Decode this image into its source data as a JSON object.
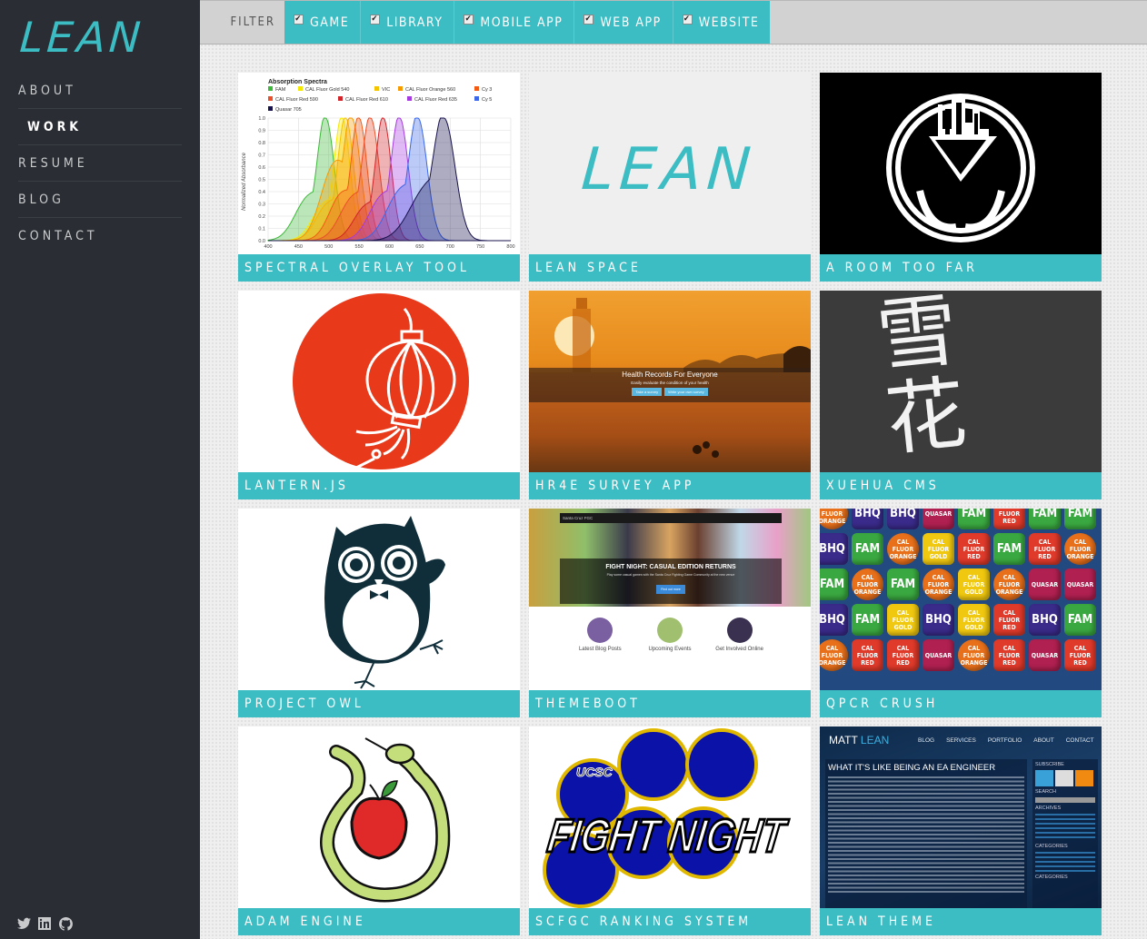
{
  "brand": {
    "logo": "LEAN",
    "accent": "#3cbcc3"
  },
  "nav": {
    "items": [
      {
        "label": "ABOUT",
        "active": false
      },
      {
        "label": "WORK",
        "active": true
      },
      {
        "label": "RESUME",
        "active": false
      },
      {
        "label": "BLOG",
        "active": false
      },
      {
        "label": "CONTACT",
        "active": false
      }
    ]
  },
  "social": [
    "twitter-icon",
    "linkedin-icon",
    "github-icon"
  ],
  "filter": {
    "label": "FILTER",
    "options": [
      {
        "label": "GAME",
        "checked": true
      },
      {
        "label": "LIBRARY",
        "checked": true
      },
      {
        "label": "MOBILE APP",
        "checked": true
      },
      {
        "label": "WEB APP",
        "checked": true
      },
      {
        "label": "WEBSITE",
        "checked": true
      }
    ]
  },
  "projects": [
    {
      "title": "SPECTRAL OVERLAY TOOL"
    },
    {
      "title": "LEAN SPACE",
      "thumb_text": "LEAN"
    },
    {
      "title": "A ROOM TOO FAR"
    },
    {
      "title": "LANTERN.JS"
    },
    {
      "title": "HR4E SURVEY APP",
      "thumb_heading": "Health Records For Everyone",
      "thumb_sub": "Easily evaluate the condition of your health",
      "thumb_btn1": "Take a survey",
      "thumb_btn2": "Write your own survey"
    },
    {
      "title": "XUEHUA CMS",
      "thumb_text": "雪花"
    },
    {
      "title": "PROJECT OWL"
    },
    {
      "title": "THEMEBOOT",
      "thumb_brand": "Santa Cruz FGC",
      "thumb_heading": "FIGHT NIGHT: CASUAL EDITION RETURNS",
      "thumb_sub": "Play some casual games with the Santa Cruz Fighting Game Community at the new venue",
      "thumb_btn": "Find out more",
      "cols": [
        "Latest Blog Posts",
        "Upcoming Events",
        "Get Involved Online"
      ]
    },
    {
      "title": "QPCR CRUSH",
      "gems": [
        "CAL FLUOR ORANGE",
        "BHQ",
        "BHQ",
        "QUASAR",
        "FAM",
        "CAL FLUOR RED",
        "FAM",
        "FAM",
        "BHQ",
        "FAM",
        "CAL FLUOR ORANGE",
        "CAL FLUOR GOLD",
        "CAL FLUOR RED",
        "FAM",
        "CAL FLUOR RED",
        "CAL FLUOR ORANGE",
        "FAM",
        "CAL FLUOR ORANGE",
        "FAM",
        "CAL FLUOR ORANGE",
        "CAL FLUOR GOLD",
        "CAL FLUOR ORANGE",
        "QUASAR",
        "QUASAR",
        "BHQ",
        "FAM",
        "CAL FLUOR GOLD",
        "BHQ",
        "CAL FLUOR GOLD",
        "CAL FLUOR RED",
        "BHQ",
        "FAM",
        "CAL FLUOR ORANGE",
        "CAL FLUOR RED",
        "CAL FLUOR RED",
        "QUASAR",
        "CAL FLUOR ORANGE",
        "CAL FLUOR RED",
        "QUASAR",
        "CAL FLUOR RED"
      ]
    },
    {
      "title": "ADAM ENGINE"
    },
    {
      "title": "SCFGC RANKING SYSTEM",
      "thumb_small": "UCSC",
      "thumb_text": "FIGHT NIGHT"
    },
    {
      "title": "LEAN THEME",
      "thumb_brand1": "MATT",
      "thumb_brand2": "LEAN",
      "thumb_nav": [
        "BLOG",
        "SERVICES",
        "PORTFOLIO",
        "ABOUT",
        "CONTACT"
      ],
      "thumb_heading": "WHAT IT'S LIKE BEING AN EA ENGINEER",
      "thumb_side": [
        "SUBSCRIBE",
        "SEARCH",
        "ARCHIVES",
        "CATEGORIES",
        "CATEGORIES"
      ]
    }
  ],
  "chart_data": {
    "type": "area",
    "title": "Absorption Spectra",
    "xlabel": "",
    "ylabel": "Normalized Absorbance",
    "xlim": [
      400,
      800
    ],
    "ylim": [
      0,
      1.0
    ],
    "xticks": [
      400,
      450,
      500,
      550,
      600,
      650,
      700,
      750,
      800
    ],
    "yticks": [
      0.0,
      0.1,
      0.2,
      0.3,
      0.4,
      0.5,
      0.6,
      0.7,
      0.8,
      0.9,
      1.0
    ],
    "legend": "top",
    "series": [
      {
        "name": "FAM",
        "color": "#3db83a",
        "peak": 495,
        "width": 14,
        "shoulder": 0.35
      },
      {
        "name": "CAL Fluor Gold 540",
        "color": "#f5e800",
        "peak": 522,
        "width": 13,
        "shoulder": 0.3
      },
      {
        "name": "VIC",
        "color": "#f5c400",
        "peak": 528,
        "width": 13,
        "shoulder": 0.3
      },
      {
        "name": "CAL Fluor Orange 560",
        "color": "#f59a00",
        "peak": 538,
        "width": 14,
        "shoulder": 0.62
      },
      {
        "name": "Cy 3",
        "color": "#f25a14",
        "peak": 550,
        "width": 13,
        "shoulder": 0.38
      },
      {
        "name": "CAL Fluor Red 590",
        "color": "#e84f2a",
        "peak": 569,
        "width": 14,
        "shoulder": 0.35
      },
      {
        "name": "CAL Fluor Red 610",
        "color": "#d0242a",
        "peak": 590,
        "width": 13,
        "shoulder": 0.28
      },
      {
        "name": "CAL Fluor Red 635",
        "color": "#a43ae0",
        "peak": 617,
        "width": 14,
        "shoulder": 0.36
      },
      {
        "name": "Cy 5",
        "color": "#3c67e8",
        "peak": 647,
        "width": 15,
        "shoulder": 0.4
      },
      {
        "name": "Quasar 705",
        "color": "#17124d",
        "peak": 690,
        "width": 18,
        "shoulder": 0.42
      }
    ]
  }
}
